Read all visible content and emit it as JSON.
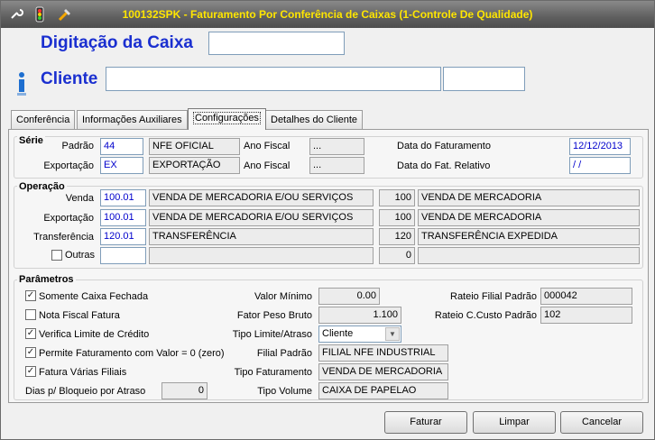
{
  "window": {
    "title": "100132SPK - Faturamento Por Conferência de Caixas (1-Controle De Qualidade)",
    "icons": [
      "wrench-icon",
      "traffic-light-icon",
      "tools-icon"
    ]
  },
  "header": {
    "caixa_label": "Digitação da Caixa",
    "caixa_value": "",
    "cliente_label": "Cliente",
    "cliente_name": "",
    "cliente_code": ""
  },
  "tabs": [
    {
      "label": "Conferência"
    },
    {
      "label": "Informações Auxiliares"
    },
    {
      "label": "Configurações"
    },
    {
      "label": "Detalhes do Cliente"
    }
  ],
  "serie": {
    "title": "Série",
    "padrao_label": "Padrão",
    "padrao_code": "44",
    "padrao_desc": "NFE OFICIAL",
    "ano_fiscal_label": "Ano Fiscal",
    "ano_fiscal_1": "...",
    "data_fat_label": "Data  do Faturamento",
    "data_fat": "12/12/2013",
    "exportacao_label": "Exportação",
    "export_code": "EX",
    "export_desc": "EXPORTAÇÃO",
    "ano_fiscal_2": "...",
    "data_rel_label": "Data  do Fat. Relativo",
    "data_rel": " / /"
  },
  "operacao": {
    "title": "Operação",
    "rows": [
      {
        "label": "Venda",
        "code": "100.01",
        "desc": "VENDA DE MERCADORIA E/OU SERVIÇOS",
        "num": "100",
        "desc2": "VENDA DE MERCADORIA"
      },
      {
        "label": "Exportação",
        "code": "100.01",
        "desc": "VENDA DE MERCADORIA E/OU SERVIÇOS",
        "num": "100",
        "desc2": "VENDA DE MERCADORIA"
      },
      {
        "label": "Transferência",
        "code": "120.01",
        "desc": "TRANSFERÊNCIA",
        "num": "120",
        "desc2": "TRANSFERÊNCIA EXPEDIDA"
      },
      {
        "label": "Outras",
        "code": "",
        "desc": "",
        "num": "0",
        "desc2": ""
      }
    ]
  },
  "parametros": {
    "title": "Parâmetros",
    "checks": [
      {
        "label": "Somente Caixa Fechada",
        "checked": "✓"
      },
      {
        "label": "Nota Fiscal Fatura",
        "checked": ""
      },
      {
        "label": "Verifica Limite de Crédito",
        "checked": "✓"
      },
      {
        "label": "Permite Faturamento com Valor = 0 (zero)",
        "checked": "✓"
      },
      {
        "label": "Fatura Várias Filiais",
        "checked": "✓"
      }
    ],
    "dias_label": "Dias p/ Bloqueio por Atraso",
    "dias_value": "0",
    "valor_minimo_label": "Valor Mínimo",
    "valor_minimo": "0.00",
    "fator_peso_label": "Fator Peso Bruto",
    "fator_peso": "1.100",
    "tipo_limite_label": "Tipo Limite/Atraso",
    "tipo_limite": "Cliente",
    "filial_padrao_label": "Filial Padrão",
    "filial_padrao": "FILIAL NFE INDUSTRIAL",
    "tipo_fat_label": "Tipo Faturamento",
    "tipo_fat": "VENDA DE MERCADORIA",
    "tipo_volume_label": "Tipo Volume",
    "tipo_volume": "CAIXA DE PAPELAO",
    "rateio_filial_label": "Rateio Filial Padrão",
    "rateio_filial": "000042",
    "rateio_custo_label": "Rateio C.Custo Padrão",
    "rateio_custo": "102"
  },
  "buttons": {
    "faturar": "Faturar",
    "limpar": "Limpar",
    "cancelar": "Cancelar"
  }
}
